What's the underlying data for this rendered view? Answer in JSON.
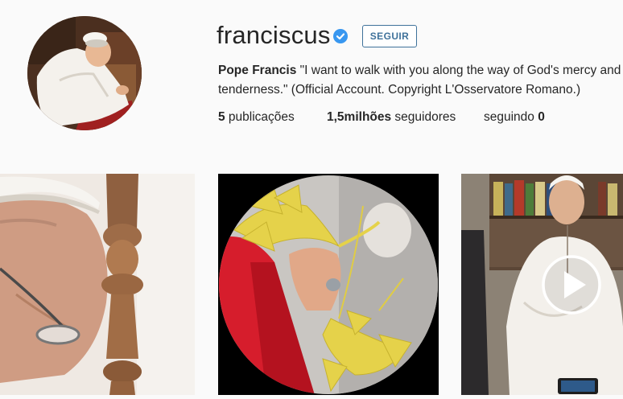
{
  "profile": {
    "username": "franciscus",
    "follow_label": "SEGUIR",
    "avatar_icon": "pope-avatar",
    "verified_icon": "verified-badge-icon",
    "accent_color": "#3f729b",
    "verified_color": "#3897f0"
  },
  "bio": {
    "name": "Pope Francis",
    "text": " \"I want to walk with you along the way of God's mercy and tenderness.\" (Official Account. Copyright L'Osservatore Romano.)"
  },
  "stats": {
    "posts_count": "5",
    "posts_label": " publicações",
    "followers_count": "1,5milhões",
    "followers_label": " seguidores",
    "following_label": "seguindo ",
    "following_count": "0"
  },
  "posts": [
    {
      "type": "photo"
    },
    {
      "type": "photo"
    },
    {
      "type": "video",
      "overlay_icon": "play-icon"
    }
  ]
}
